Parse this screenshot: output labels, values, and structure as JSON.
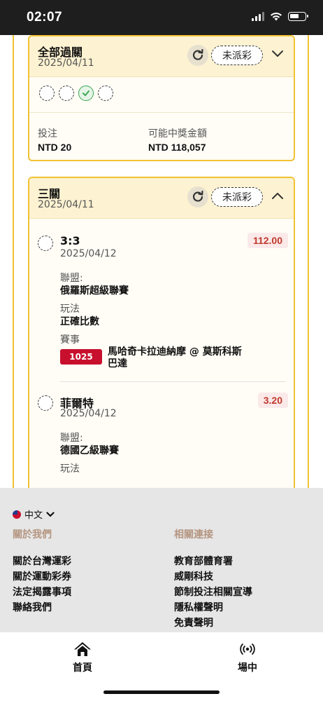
{
  "status_bar": {
    "time": "02:07"
  },
  "bets": [
    {
      "title": "全部過關",
      "date": "2025/04/11",
      "status": "未派彩",
      "stake_label": "投注",
      "stake_value": "NTD 20",
      "payout_label": "可能中獎金額",
      "payout_value": "NTD 118,057"
    },
    {
      "title": "三關",
      "date": "2025/04/11",
      "status": "未派彩",
      "legs": [
        {
          "title": "3:3",
          "date": "2025/04/12",
          "odds": "112.00",
          "league_label": "聯盟:",
          "league": "俄羅斯超級聯賽",
          "market_label": "玩法",
          "market": "正確比數",
          "event_label": "賽事",
          "match_no": "1025",
          "match": "馬哈奇卡拉迪納摩 @ 莫斯科斯巴達"
        },
        {
          "title": "菲爾特",
          "date": "2025/04/12",
          "odds": "3.20",
          "league_label": "聯盟:",
          "league": "德國乙級聯賽",
          "market_label": "玩法"
        }
      ]
    }
  ],
  "footer": {
    "language": "中文",
    "about_heading": "關於我們",
    "about_links": [
      "關於台灣運彩",
      "關於運動彩券",
      "法定揭露事項",
      "聯絡我們"
    ],
    "links_heading": "相關連接",
    "related_links": [
      "教育部體育署",
      "威剛科技",
      "節制投注相關宣導",
      "隱私權聲明",
      "免責聲明"
    ]
  },
  "tabbar": {
    "home_label": "首頁",
    "live_label": "場中"
  },
  "colors": {
    "accent": "#f1c232",
    "header_bg": "#fdf2d1",
    "odds": "#c0392b",
    "match_badge": "#c8102e",
    "success": "#3aa853"
  }
}
